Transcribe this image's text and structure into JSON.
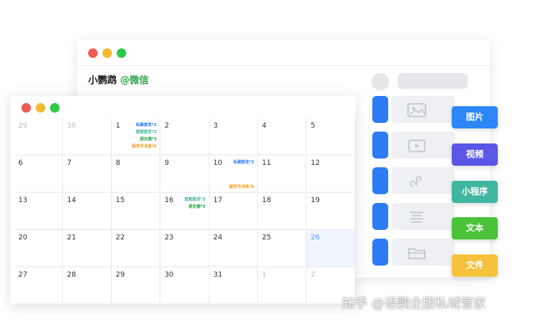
{
  "colors": {
    "accent_blue": "#2d7cf6",
    "wechat_green": "#2aa845",
    "today_bg": "#eef5fd"
  },
  "back_window": {
    "title": "小鹦鹉",
    "handle": "@微信",
    "message_glyphs": [
      "image-icon",
      "video-icon",
      "miniprogram-icon",
      "text-icon",
      "folder-icon"
    ]
  },
  "tags": [
    {
      "label": "图片",
      "color": "#2d87f7"
    },
    {
      "label": "视频",
      "color": "#5b57e6"
    },
    {
      "label": "小程序",
      "color": "#3fb6a0"
    },
    {
      "label": "文本",
      "color": "#4ac23a"
    },
    {
      "label": "文件",
      "color": "#f6c23b"
    }
  ],
  "calendar": {
    "weeks": [
      [
        {
          "day": "29",
          "muted": true
        },
        {
          "day": "30",
          "muted": true
        },
        {
          "day": "1"
        },
        {
          "day": "2"
        },
        {
          "day": "3"
        },
        {
          "day": "4"
        },
        {
          "day": "5"
        }
      ],
      [
        {
          "day": "6"
        },
        {
          "day": "7"
        },
        {
          "day": "8"
        },
        {
          "day": "9"
        },
        {
          "day": "10"
        },
        {
          "day": "11"
        },
        {
          "day": "12"
        }
      ],
      [
        {
          "day": "13"
        },
        {
          "day": "14"
        },
        {
          "day": "15"
        },
        {
          "day": "16"
        },
        {
          "day": "17"
        },
        {
          "day": "18"
        },
        {
          "day": "19"
        }
      ],
      [
        {
          "day": "20"
        },
        {
          "day": "21"
        },
        {
          "day": "22"
        },
        {
          "day": "23"
        },
        {
          "day": "24"
        },
        {
          "day": "25"
        },
        {
          "day": "26",
          "today": true
        }
      ],
      [
        {
          "day": "27"
        },
        {
          "day": "28"
        },
        {
          "day": "29"
        },
        {
          "day": "30"
        },
        {
          "day": "31"
        },
        {
          "day": "1",
          "muted": true
        },
        {
          "day": "2",
          "muted": true
        }
      ]
    ],
    "events": {
      "w0d2": [
        {
          "text": "私聊群发*2",
          "color": "#2d7cf6"
        },
        {
          "text": "群群群发*3",
          "color": "#3fb6a0"
        },
        {
          "text": "朋友圈*3",
          "color": "#2aa845"
        },
        {
          "text": "服务号消息*6",
          "color": "#f0a020"
        }
      ],
      "w1d4": [
        {
          "text": "私聊群发*2",
          "color": "#2d7cf6"
        },
        {
          "text": "服务号消息*6",
          "color": "#f0a020"
        }
      ],
      "w2d3": [
        {
          "text": "群群群发*3",
          "color": "#3fb6a0"
        },
        {
          "text": "朋友圈*3",
          "color": "#2aa845"
        }
      ]
    }
  },
  "watermark": "知乎 @语鹦企服私域管家"
}
